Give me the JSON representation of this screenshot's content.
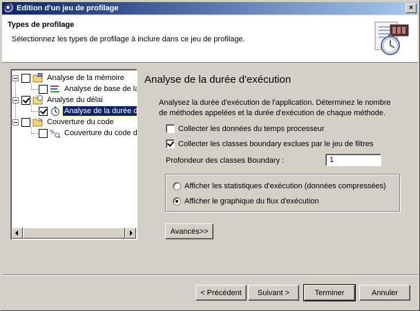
{
  "window": {
    "title": "Edition d'un jeu de profilage",
    "close_glyph": "×"
  },
  "header": {
    "title": "Types de profilage",
    "description": "Sélectionnez les types de profilage à inclure dans ce jeu de profilage."
  },
  "tree": {
    "items": [
      {
        "label": "Analyse de la mémoire",
        "checked": false,
        "level": 0,
        "icon": "folder-memory-icon"
      },
      {
        "label": "Analyse de base de la",
        "checked": false,
        "level": 1,
        "icon": "memory-analysis-icon"
      },
      {
        "label": "Analyse du délai",
        "checked": true,
        "level": 0,
        "icon": "folder-clock-icon"
      },
      {
        "label": "Analyse de la durée d'",
        "checked": true,
        "level": 1,
        "icon": "stopwatch-icon",
        "selected": true
      },
      {
        "label": "Couverture du code",
        "checked": false,
        "level": 0,
        "icon": "folder-percent-icon"
      },
      {
        "label": "Couverture du code d",
        "checked": false,
        "level": 1,
        "icon": "code-coverage-icon"
      }
    ]
  },
  "panel": {
    "title": "Analyse de la durée d'exécution",
    "description": "Analysez la durée d'exécution de l'application. Déterminez le nombre de méthodes appelées et la durée d'exécution de chaque méthode.",
    "options": [
      {
        "label": "Collecter les données du temps processeur",
        "checked": false
      },
      {
        "label": "Collecter les classes boundary exclues par le jeu de filtres",
        "checked": true
      }
    ],
    "depth_label": "Profondeur des classes Boundary :",
    "depth_value": "1",
    "radios": [
      {
        "label": "Afficher les statistiques d'exécution (données compressées)",
        "selected": false
      },
      {
        "label": "Afficher le graphique du flux d'exécution",
        "selected": true
      }
    ],
    "advanced_button": "Avancés>>"
  },
  "footer": {
    "previous": "< Précédent",
    "next": "Suivant >",
    "finish": "Terminer",
    "cancel": "Annuler"
  }
}
